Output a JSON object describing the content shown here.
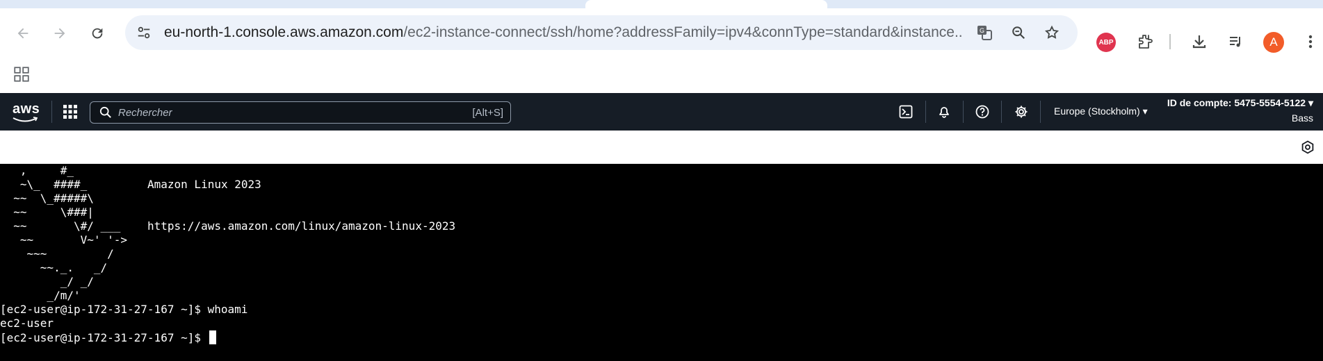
{
  "browser": {
    "url_host": "eu-north-1.console.aws.amazon.com",
    "url_path": "/ec2-instance-connect/ssh/home?addressFamily=ipv4&connType=standard&instance...",
    "avatar_letter": "A",
    "abp_label": "ABP",
    "icons": [
      "back-arrow-icon",
      "forward-arrow-icon",
      "reload-icon",
      "site-info-icon",
      "translate-icon",
      "zoom-icon",
      "star-icon",
      "adblock-icon",
      "extensions-icon",
      "download-icon",
      "media-control-icon",
      "kebab-menu-icon",
      "apps-grid-icon"
    ]
  },
  "aws": {
    "logo_text": "aws",
    "search_placeholder": "Rechercher",
    "search_shortcut": "[Alt+S]",
    "region": "Europe (Stockholm) ▾",
    "account": "ID de compte: 5475-5554-5122 ▾",
    "account_sub": "Bass",
    "brand_color": "#161d26"
  },
  "terminal": {
    "ascii_art": "   ,     #_\n   ~\\_  ####_\n  ~~  \\_#####\\\n  ~~     \\###|\n  ~~       \\#/ ___\n   ~~       V~' '->\n    ~~~         /\n      ~~._.   _/\n         _/ _/\n       _/m/'",
    "banner_title": "Amazon Linux 2023",
    "banner_url": "https://aws.amazon.com/linux/amazon-linux-2023",
    "lines": [
      "[ec2-user@ip-172-31-27-167 ~]$ whoami",
      "ec2-user",
      "[ec2-user@ip-172-31-27-167 ~]$ "
    ]
  }
}
